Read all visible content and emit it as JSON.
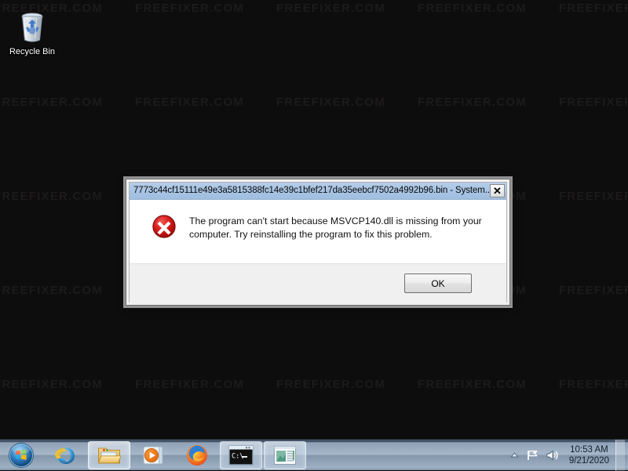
{
  "desktop": {
    "watermark_text": "FREEFIXER.COM",
    "background_color": "#0e0d0d",
    "icons": [
      {
        "name": "recycle-bin",
        "label": "Recycle Bin"
      }
    ]
  },
  "dialog": {
    "title": "7773c44cf15111e49e3a5815388fc14e39c1bfef217da35eebcf7502a4992b96.bin - System...",
    "close_label": "✕",
    "icon": "error-icon",
    "message": "The program can't start because MSVCP140.dll is missing from your computer. Try reinstalling the program to fix this problem.",
    "buttons": [
      {
        "label": "OK",
        "name": "ok-button",
        "default": true
      }
    ],
    "title_bar_color": "#a8c4e4",
    "error_color": "#c00000"
  },
  "taskbar": {
    "start_label": "Start",
    "items": [
      {
        "name": "internet-explorer",
        "label": "Internet Explorer",
        "state": "pinned"
      },
      {
        "name": "windows-explorer",
        "label": "Windows Explorer",
        "state": "pinned-open"
      },
      {
        "name": "windows-media-player",
        "label": "Windows Media Player",
        "state": "pinned"
      },
      {
        "name": "firefox",
        "label": "Mozilla Firefox",
        "state": "pinned"
      },
      {
        "name": "command-prompt",
        "label": "Command Prompt",
        "state": "running"
      },
      {
        "name": "document-window",
        "label": "Document Window",
        "state": "running"
      }
    ],
    "tray": {
      "show_hidden_label": "Show hidden icons",
      "action_center_label": "Action Center",
      "volume_label": "Speakers",
      "time": "10:53 AM",
      "date": "9/21/2020"
    }
  }
}
